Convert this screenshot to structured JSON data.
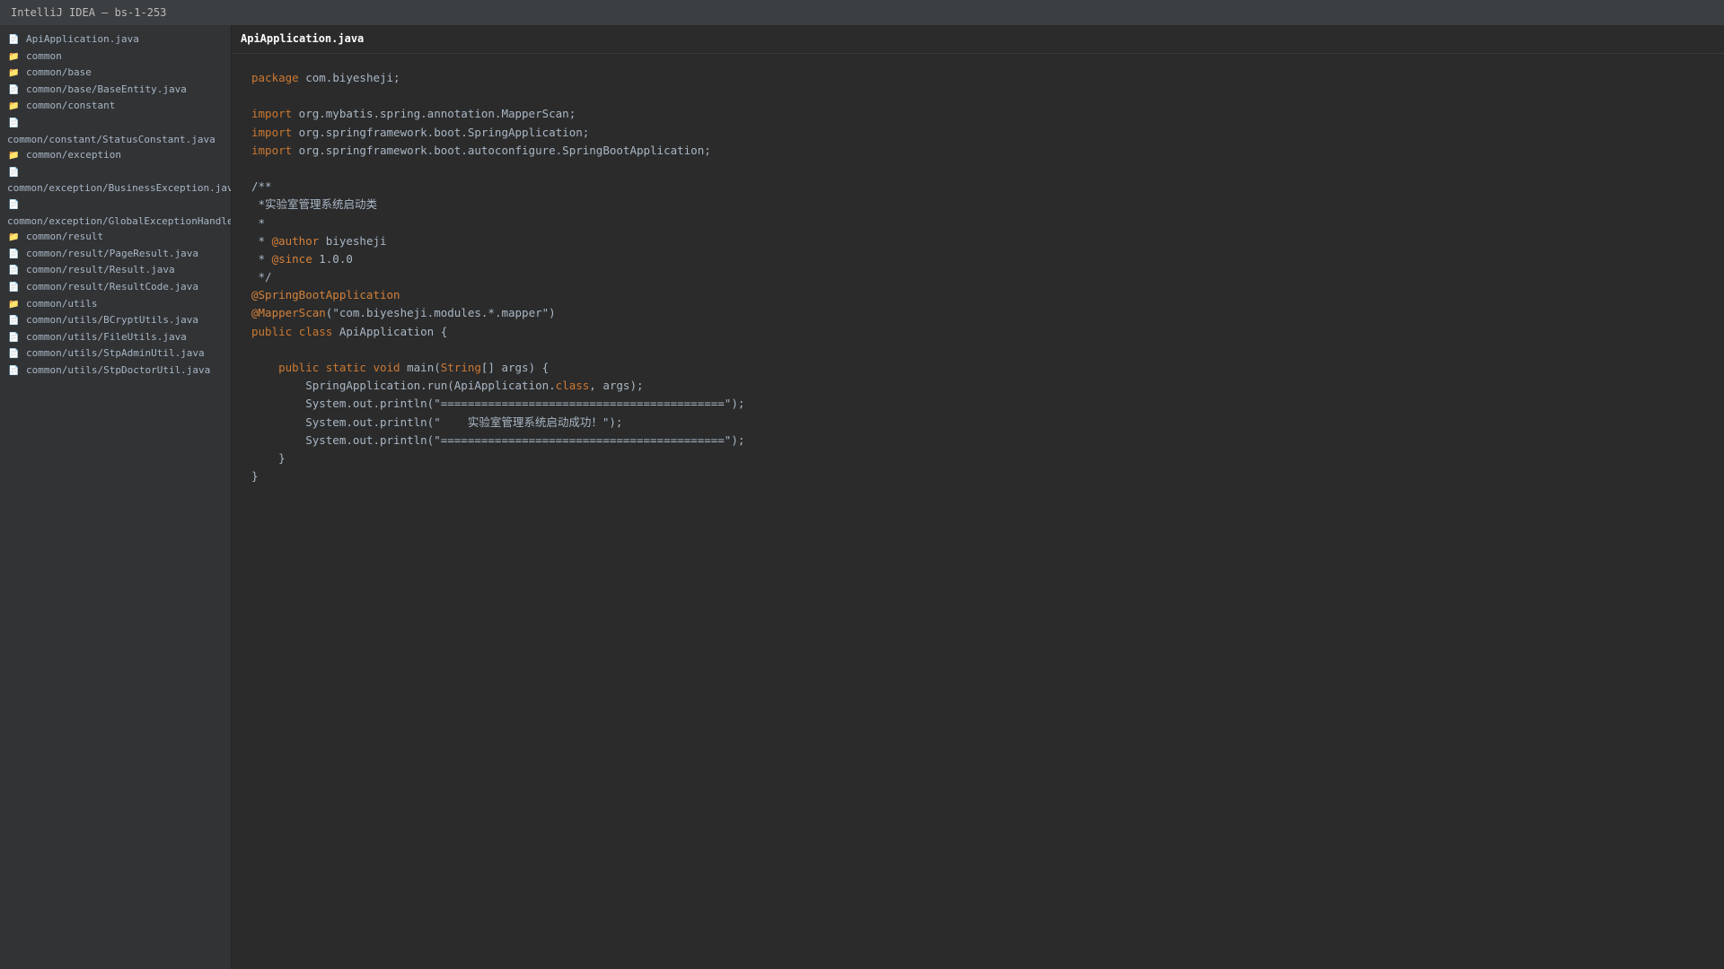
{
  "window": {
    "title": "IntelliJ IDEA — bs-1-253"
  },
  "project_tree": {
    "items": [
      {
        "type": "file",
        "label": "ApiApplication.java",
        "icon": "file-icon"
      },
      {
        "type": "folder",
        "label": "common",
        "icon": "folder-icon"
      },
      {
        "type": "folder",
        "label": "common/base",
        "icon": "folder-icon"
      },
      {
        "type": "file",
        "label": "common/base/BaseEntity.java",
        "icon": "file-icon"
      },
      {
        "type": "folder",
        "label": "common/constant",
        "icon": "folder-icon"
      },
      {
        "type": "file",
        "label": "common/constant/StatusConstant.java",
        "icon": "file-icon",
        "wrapped": true
      },
      {
        "type": "folder",
        "label": "common/exception",
        "icon": "folder-icon"
      },
      {
        "type": "file",
        "label": "common/exception/BusinessException.java",
        "icon": "file-icon",
        "wrapped": true
      },
      {
        "type": "file",
        "label": "common/exception/GlobalExceptionHandler.java",
        "icon": "file-icon",
        "wrapped": true
      },
      {
        "type": "folder",
        "label": "common/result",
        "icon": "folder-icon"
      },
      {
        "type": "file",
        "label": "common/result/PageResult.java",
        "icon": "file-icon"
      },
      {
        "type": "file",
        "label": "common/result/Result.java",
        "icon": "file-icon"
      },
      {
        "type": "file",
        "label": "common/result/ResultCode.java",
        "icon": "file-icon"
      },
      {
        "type": "folder",
        "label": "common/utils",
        "icon": "folder-icon"
      },
      {
        "type": "file",
        "label": "common/utils/BCryptUtils.java",
        "icon": "file-icon"
      },
      {
        "type": "file",
        "label": "common/utils/FileUtils.java",
        "icon": "file-icon"
      },
      {
        "type": "file",
        "label": "common/utils/StpAdminUtil.java",
        "icon": "file-icon"
      },
      {
        "type": "file",
        "label": "common/utils/StpDoctorUtil.java",
        "icon": "file-icon"
      }
    ]
  },
  "editor": {
    "active_tab": "ApiApplication.java",
    "code_lines": [
      [
        {
          "t": "package",
          "c": "kw"
        },
        {
          "t": " com.biyesheji;"
        }
      ],
      [],
      [
        {
          "t": "import",
          "c": "kw"
        },
        {
          "t": " org.mybatis.spring.annotation.MapperScan;"
        }
      ],
      [
        {
          "t": "import",
          "c": "kw"
        },
        {
          "t": " org.springframework.boot.SpringApplication;"
        }
      ],
      [
        {
          "t": "import",
          "c": "kw"
        },
        {
          "t": " org.springframework.boot.autoconfigure.SpringBootApplication;"
        }
      ],
      [],
      [
        {
          "t": "/**",
          "c": "cm"
        }
      ],
      [
        {
          "t": " *实验室管理系统启动类",
          "c": "cm"
        }
      ],
      [
        {
          "t": " *",
          "c": "cm"
        }
      ],
      [
        {
          "t": " * ",
          "c": "cm"
        },
        {
          "t": "@author",
          "c": "tag"
        },
        {
          "t": " biyesheji",
          "c": "cm"
        }
      ],
      [
        {
          "t": " * ",
          "c": "cm"
        },
        {
          "t": "@since",
          "c": "tag"
        },
        {
          "t": " 1.0.0",
          "c": "cm"
        }
      ],
      [
        {
          "t": " */",
          "c": "cm"
        }
      ],
      [
        {
          "t": "@SpringBootApplication",
          "c": "tag"
        }
      ],
      [
        {
          "t": "@MapperScan",
          "c": "tag"
        },
        {
          "t": "(\"com.biyesheji.modules.*.mapper\")"
        }
      ],
      [
        {
          "t": "public",
          "c": "kw"
        },
        {
          "t": " "
        },
        {
          "t": "class",
          "c": "kw"
        },
        {
          "t": " ApiApplication {"
        }
      ],
      [],
      [
        {
          "t": "    "
        },
        {
          "t": "public",
          "c": "kw"
        },
        {
          "t": " "
        },
        {
          "t": "static",
          "c": "kw"
        },
        {
          "t": " "
        },
        {
          "t": "void",
          "c": "kw"
        },
        {
          "t": " main("
        },
        {
          "t": "String",
          "c": "kw"
        },
        {
          "t": "[] args) {"
        }
      ],
      [
        {
          "t": "        SpringApplication.run(ApiApplication."
        },
        {
          "t": "class",
          "c": "kw"
        },
        {
          "t": ", args);"
        }
      ],
      [
        {
          "t": "        System.out.println(\"==========================================\");"
        }
      ],
      [
        {
          "t": "        System.out.println(\"    实验室管理系统启动成功！\");"
        }
      ],
      [
        {
          "t": "        System.out.println(\"==========================================\");"
        }
      ],
      [
        {
          "t": "    }"
        }
      ],
      [
        {
          "t": "}"
        }
      ]
    ]
  }
}
